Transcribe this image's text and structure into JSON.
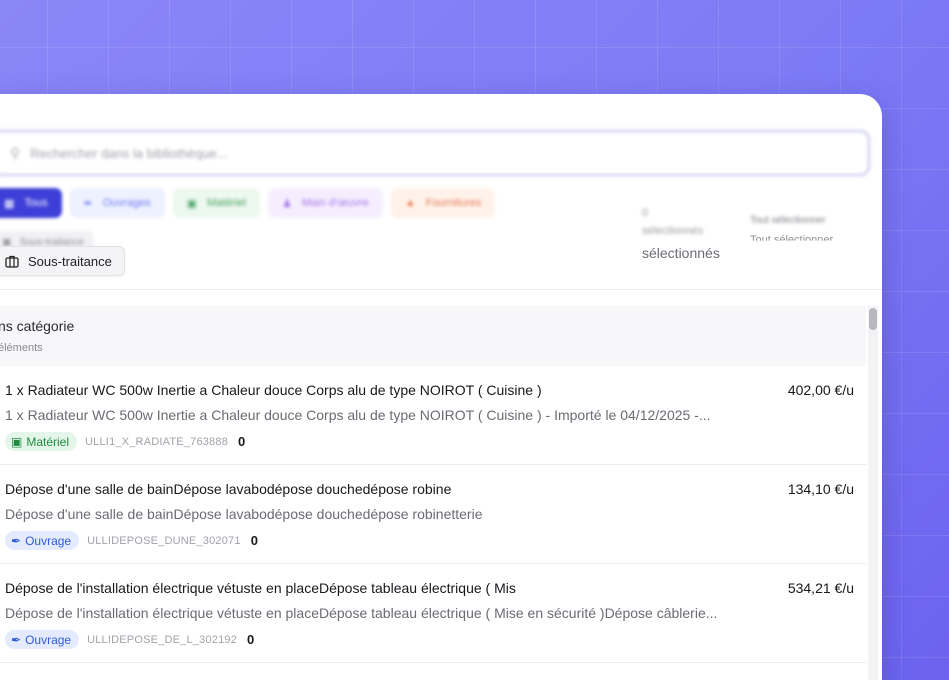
{
  "search": {
    "placeholder": "Rechercher dans la bibliothèque..."
  },
  "filters": {
    "items": [
      {
        "label": "Tous",
        "active": true
      },
      {
        "label": "Ouvrages"
      },
      {
        "label": "Matériel"
      },
      {
        "label": "Main d'œuvre"
      },
      {
        "label": "Fournitures"
      }
    ],
    "sous_traitance": "Sous-traitance"
  },
  "selection": {
    "count": "0",
    "count_label": "sélectionnés",
    "select_all": "Tout sélectionner"
  },
  "category": {
    "title": "ns catégorie",
    "subtitle": "éléments"
  },
  "items": [
    {
      "title": "1 x Radiateur WC 500w Inertie a Chaleur douce Corps alu de type NOIROT ( Cuisine )",
      "price": "402,00 €/u",
      "description": "1 x Radiateur WC 500w Inertie a Chaleur douce Corps alu de type NOIROT ( Cuisine ) - Importé le 04/12/2025 -...",
      "tag": "Matériel",
      "ref": "ULLI1_X_RADIATE_763888",
      "qty": "0"
    },
    {
      "title": "Dépose d'une salle de bainDépose lavabodépose douchedépose robine",
      "price": "134,10 €/u",
      "description": "Dépose d'une salle de bainDépose lavabodépose douchedépose robinetterie",
      "tag": "Ouvrage",
      "ref": "ULLIDEPOSE_DUNE_302071",
      "qty": "0"
    },
    {
      "title": "Dépose de l'installation électrique vétuste en placeDépose tableau électrique ( Mis",
      "price": "534,21 €/u",
      "description": "Dépose de l'installation électrique vétuste en placeDépose tableau électrique ( Mise en sécurité )Dépose câblerie...",
      "tag": "Ouvrage",
      "ref": "ULLIDEPOSE_DE_L_302192",
      "qty": "0"
    }
  ],
  "colors": {
    "accent": "#3e3fd8",
    "background": "#7d7af5",
    "tag_materiel": "#1e8a3e",
    "tag_ouvrage": "#2f5bd8"
  }
}
